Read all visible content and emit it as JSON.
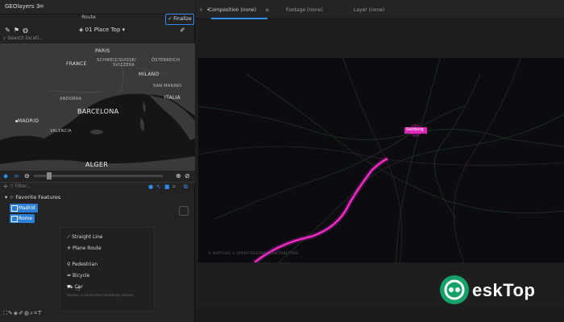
{
  "panel": {
    "title": "GEOlayers 3",
    "menu_glyph": "≡",
    "route_tab": "Route",
    "finalize": "✓ Finalize"
  },
  "toolbar": {
    "place_select": "01 Place Top ▾"
  },
  "search": {
    "placeholder": "Search locati..."
  },
  "map_labels": [
    {
      "id": "paris",
      "text": "PARIS",
      "cls": ""
    },
    {
      "id": "france",
      "text": "FRANCE",
      "cls": ""
    },
    {
      "id": "schweiz",
      "text": "SCHWEIZ/SUISSE/",
      "cls": "sm"
    },
    {
      "id": "svizzera",
      "text": "SVIZZERA",
      "cls": "sm"
    },
    {
      "id": "osterreich",
      "text": "ÖSTERREICH",
      "cls": "sm"
    },
    {
      "id": "milano",
      "text": "MILANO",
      "cls": ""
    },
    {
      "id": "sanmarino",
      "text": "SAN MARINO",
      "cls": "sm"
    },
    {
      "id": "andorra",
      "text": "ANDORRA",
      "cls": "sm"
    },
    {
      "id": "barcelona",
      "text": "BARCELONA",
      "cls": "big"
    },
    {
      "id": "italia",
      "text": "ITALIA",
      "cls": ""
    },
    {
      "id": "madrid",
      "text": "MADRID",
      "cls": ""
    },
    {
      "id": "valencia",
      "text": "VALENCIA",
      "cls": "sm"
    },
    {
      "id": "alger",
      "text": "ALGER",
      "cls": "big"
    }
  ],
  "filter": {
    "placeholder": "Filter..."
  },
  "favorites": {
    "label": "Favorite Features",
    "items": [
      "Madrid",
      "Rome"
    ]
  },
  "context_menu": {
    "items": [
      "Straight Line",
      "Plane Route",
      "Pedestrian",
      "Bicycle",
      "Car"
    ],
    "note": "Routes a connection between places"
  },
  "tabs": {
    "composition": "Composition (none)",
    "footage": "Footage (none)",
    "layer": "Layer (none)"
  },
  "viewer": {
    "city_label": "Salzburg",
    "render_note": "© MAPTILER © OPENSTREETMAP CONTRIBUTORS"
  },
  "watermark": {
    "brand": "eskTop"
  },
  "colors": {
    "accent": "#2d8ceb",
    "route": "#ff2bd0",
    "chip": "#2d7fd6",
    "brand": "#15a36a"
  }
}
